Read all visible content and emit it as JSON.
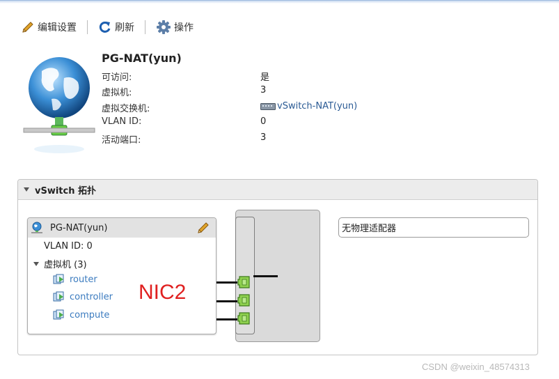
{
  "toolbar": {
    "edit_label": "编辑设置",
    "refresh_label": "刷新",
    "actions_label": "操作"
  },
  "portgroup": {
    "title": "PG-NAT(yun)",
    "props": [
      {
        "label": "可访问:",
        "value": "是"
      },
      {
        "label": "虚拟机:",
        "value": "3"
      },
      {
        "label": "虚拟交换机:",
        "value": "vSwitch-NAT(yun)"
      },
      {
        "label": "VLAN ID:",
        "value": "0"
      },
      {
        "label": "活动端口:",
        "value": "3"
      }
    ]
  },
  "topology": {
    "header": "vSwitch 拓扑",
    "pg_name": "PG-NAT(yun)",
    "vlan": "VLAN ID: 0",
    "vm_group": "虚拟机 (3)",
    "vms": [
      "router",
      "controller",
      "compute"
    ],
    "adapter_text": "无物理适配器",
    "annotation": "NIC2"
  },
  "watermark": "CSDN @weixin_48574313",
  "icons": {
    "edit": "pencil-icon",
    "refresh": "refresh-icon",
    "actions": "gear-icon",
    "network": "globe-network-icon",
    "switch": "vswitch-icon",
    "vm": "vm-icon",
    "port": "port-icon"
  },
  "colors": {
    "link": "#2a5a94",
    "vm_link": "#3b7bbf",
    "annotation": "#e02020",
    "port_green": "#8fd14f"
  }
}
